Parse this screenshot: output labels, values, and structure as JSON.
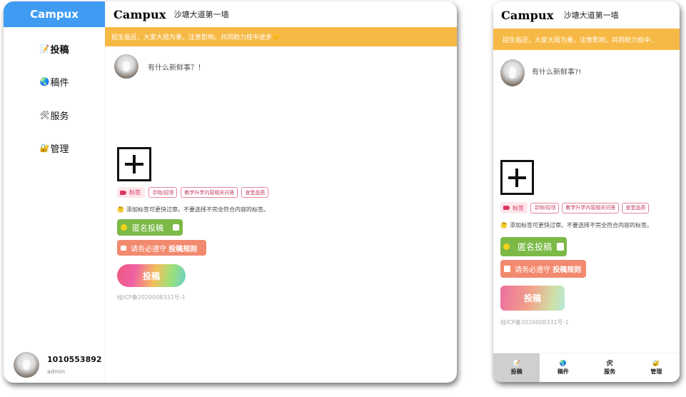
{
  "desktop": {
    "brand": "Campux",
    "nav": [
      {
        "icon": "📝",
        "label": "投稿"
      },
      {
        "icon": "🌏",
        "label": "稿件"
      },
      {
        "icon": "🛠",
        "label": "服务"
      },
      {
        "icon": "🔐",
        "label": "管理"
      }
    ],
    "user": {
      "id": "1010553892",
      "role": "admin"
    }
  },
  "header": {
    "logo": "Campux",
    "wall_name": "沙塘大道第一墙"
  },
  "banner": {
    "text": "招生临近，大家大局为重，注意影响，共同助力桂中进步🤝",
    "text_mobile": "招生临近，大家大局为重，注意影响，共同助力桂中.."
  },
  "compose": {
    "placeholder": "有什么新鲜事？！",
    "placeholder_mobile": "有什么新鲜事?!"
  },
  "tags": {
    "label": "标签",
    "options": [
      "寻物/招领",
      "教学升学内容相关问答",
      "食堂品质"
    ]
  },
  "hint": {
    "emoji": "🤔",
    "text": "添加标签可更快过审。不要选择不完全符合内容的标签。"
  },
  "anonymous": {
    "label": "匿名投稿",
    "checked": false
  },
  "rules": {
    "prefix": "请务必遵守",
    "link": "投稿规则"
  },
  "submit_label": "投稿",
  "icp": "桂ICP备2020008331号-1",
  "mobile_tabs": [
    {
      "icon": "📝",
      "label": "投稿",
      "active": true
    },
    {
      "icon": "🌏",
      "label": "稿件",
      "active": false
    },
    {
      "icon": "🛠",
      "label": "服务",
      "active": false
    },
    {
      "icon": "🔐",
      "label": "管理",
      "active": false
    }
  ],
  "colors": {
    "brand": "#3f9cf2",
    "banner": "#f7b946",
    "anon": "#7cb947",
    "rules": "#f28a6f",
    "tag": "#d9385e"
  }
}
